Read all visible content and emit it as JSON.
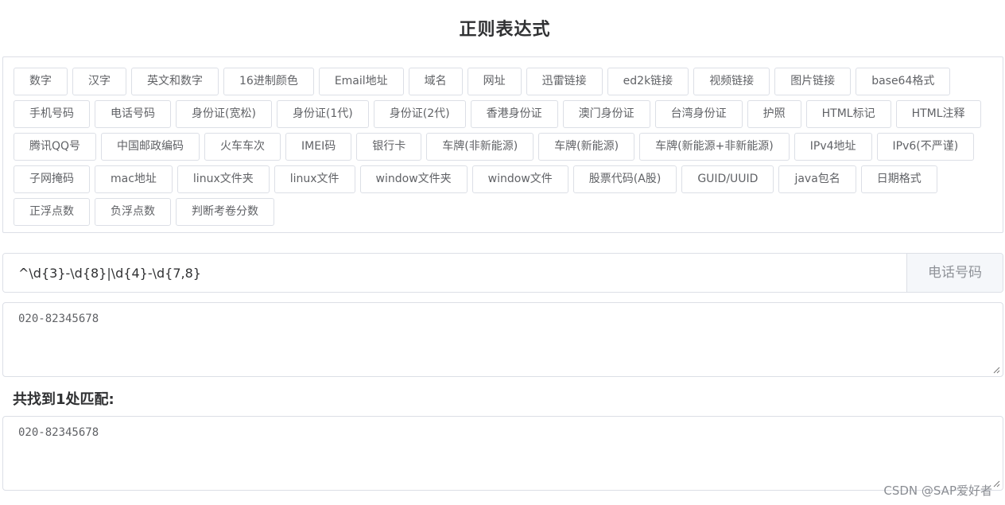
{
  "title": "正则表达式",
  "presets": [
    "数字",
    "汉字",
    "英文和数字",
    "16进制颜色",
    "Email地址",
    "域名",
    "网址",
    "迅雷链接",
    "ed2k链接",
    "视频链接",
    "图片链接",
    "base64格式",
    "手机号码",
    "电话号码",
    "身份证(宽松)",
    "身份证(1代)",
    "身份证(2代)",
    "香港身份证",
    "澳门身份证",
    "台湾身份证",
    "护照",
    "HTML标记",
    "HTML注释",
    "腾讯QQ号",
    "中国邮政编码",
    "火车车次",
    "IMEI码",
    "银行卡",
    "车牌(非新能源)",
    "车牌(新能源)",
    "车牌(新能源+非新能源)",
    "IPv4地址",
    "IPv6(不严谨)",
    "子网掩码",
    "mac地址",
    "linux文件夹",
    "linux文件",
    "window文件夹",
    "window文件",
    "股票代码(A股)",
    "GUID/UUID",
    "java包名",
    "日期格式",
    "正浮点数",
    "负浮点数",
    "判断考卷分数"
  ],
  "pattern": {
    "value": "^\\d{3}-\\d{8}|\\d{4}-\\d{7,8}",
    "append_label": "电话号码"
  },
  "source_text": "020-82345678",
  "match_summary": "共找到1处匹配:",
  "match_result": "020-82345678",
  "watermark": "CSDN @SAP爱好者"
}
